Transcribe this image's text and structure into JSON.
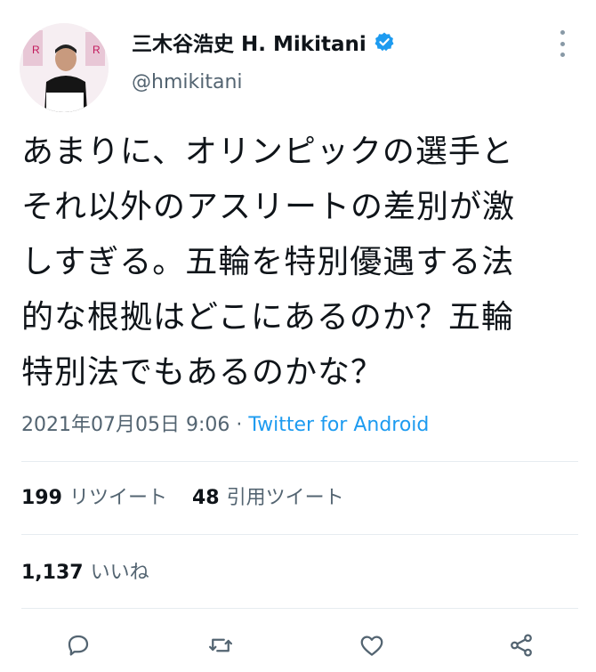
{
  "author": {
    "display_name": "三木谷浩史 H. Mikitani",
    "handle": "@hmikitani",
    "verified": true,
    "avatar_icon": "person-photo"
  },
  "tweet": {
    "text": "あまりに、オリンピックの選手と\nそれ以外のアスリートの差別が激\nしすぎる。五輪を特別優遇する法\n的な根拠はどこにあるのか？五輪\n特別法でもあるのかな？",
    "timestamp": "2021年07月05日 9:06",
    "separator": " · ",
    "source": "Twitter for Android"
  },
  "stats": {
    "retweets_count": "199",
    "retweets_label": "リツイート",
    "quotes_count": "48",
    "quotes_label": "引用ツイート",
    "likes_count": "1,137",
    "likes_label": "いいね"
  },
  "actions": [
    {
      "name": "reply-icon"
    },
    {
      "name": "retweet-icon"
    },
    {
      "name": "like-icon"
    },
    {
      "name": "share-icon"
    }
  ],
  "colors": {
    "text": "#0f1419",
    "secondary": "#536471",
    "link": "#1d9bf0",
    "verified": "#1d9bf0",
    "divider": "#e6ecf0"
  }
}
